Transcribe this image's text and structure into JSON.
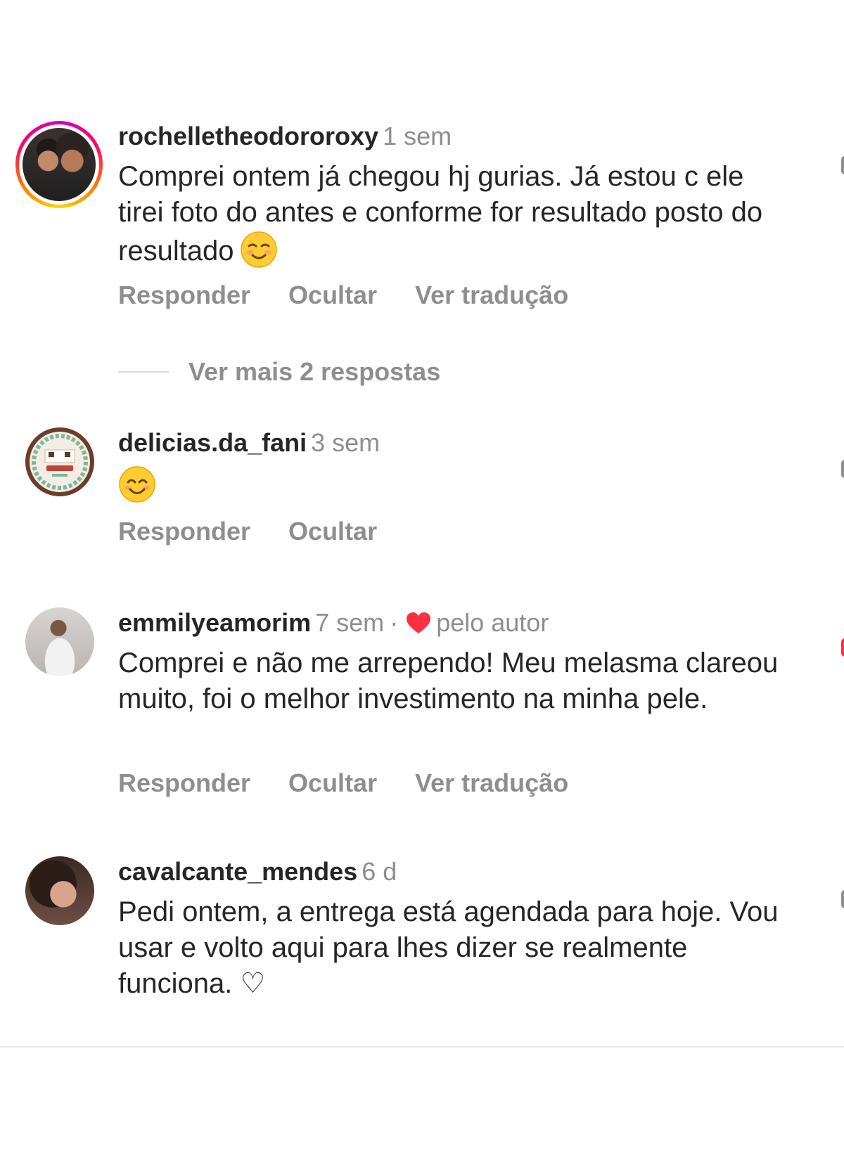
{
  "comments": [
    {
      "username": "rochelletheodororoxy",
      "time": "1 sem",
      "text": "Comprei ontem já chegou hj gurias. Já estou c ele tirei foto do antes e conforme for resultado posto do resultado",
      "emoji": "relieved-smile-emoji",
      "actions": [
        "Responder",
        "Ocultar",
        "Ver tradução"
      ]
    },
    {
      "username": "delicias.da_fani",
      "time": "3 sem",
      "emoji": "smiling-face-emoji",
      "actions": [
        "Responder",
        "Ocultar"
      ]
    },
    {
      "username": "emmilyeamorim",
      "time": "7 sem",
      "separator": "·",
      "liked_by_author": "pelo autor",
      "text": "Comprei e não me arrependo! Meu melasma clareou muito, foi o melhor investimento na minha pele.",
      "actions": [
        "Responder",
        "Ocultar",
        "Ver tradução"
      ]
    },
    {
      "username": "cavalcante_mendes",
      "time": "6 d",
      "text": "Pedi ontem, a entrega está agendada para hoje. Vou usar e volto aqui para lhes dizer se realmente funciona. ♡"
    }
  ],
  "more_replies": "Ver mais 2 respostas",
  "colors": {
    "text": "#262626",
    "secondary": "#8e8e8e",
    "heart": "#ff3040",
    "divider": "#dbdbdb"
  }
}
